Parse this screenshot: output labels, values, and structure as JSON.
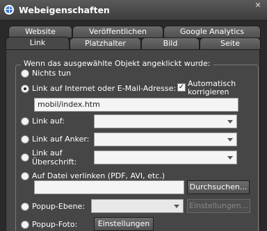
{
  "window": {
    "title": "Webeigenschaften",
    "close_glyph": "✕"
  },
  "tabs": {
    "row1": [
      "Website",
      "Veröffentlichen",
      "Google Analytics"
    ],
    "row2": [
      "Link",
      "Platzhalter",
      "Bild",
      "Seite"
    ],
    "active": "Link"
  },
  "group": {
    "title": "Wenn das ausgewählte Objekt angeklickt wurde:"
  },
  "options": {
    "none": {
      "label": "Nichts tun",
      "checked": false
    },
    "url": {
      "label": "Link auf Internet oder E-Mail-Adresse:",
      "checked": true,
      "value": "mobil/index.htm",
      "auto_correct_label": "Automatisch korrigieren",
      "auto_correct_checked": true
    },
    "link_to": {
      "label": "Link auf:",
      "checked": false,
      "value": ""
    },
    "anchor": {
      "label": "Link auf Anker:",
      "checked": false,
      "value": ""
    },
    "heading": {
      "label": "Link auf Überschrift:",
      "checked": false,
      "value": ""
    },
    "file": {
      "label": "Auf Datei verlinken (PDF, AVI, etc.)",
      "checked": false,
      "value": "",
      "browse_label": "Durchsuchen..."
    },
    "popup_layer": {
      "label": "Popup-Ebene:",
      "checked": false,
      "value": "",
      "settings_label": "Einstellungen..."
    },
    "popup_photo": {
      "label": "Popup-Foto:",
      "checked": false,
      "settings_label": "Einstellungen"
    }
  },
  "icons": {
    "title": "globe-icon",
    "dropdown": "chevron-down-icon",
    "check": "checkmark-icon"
  }
}
